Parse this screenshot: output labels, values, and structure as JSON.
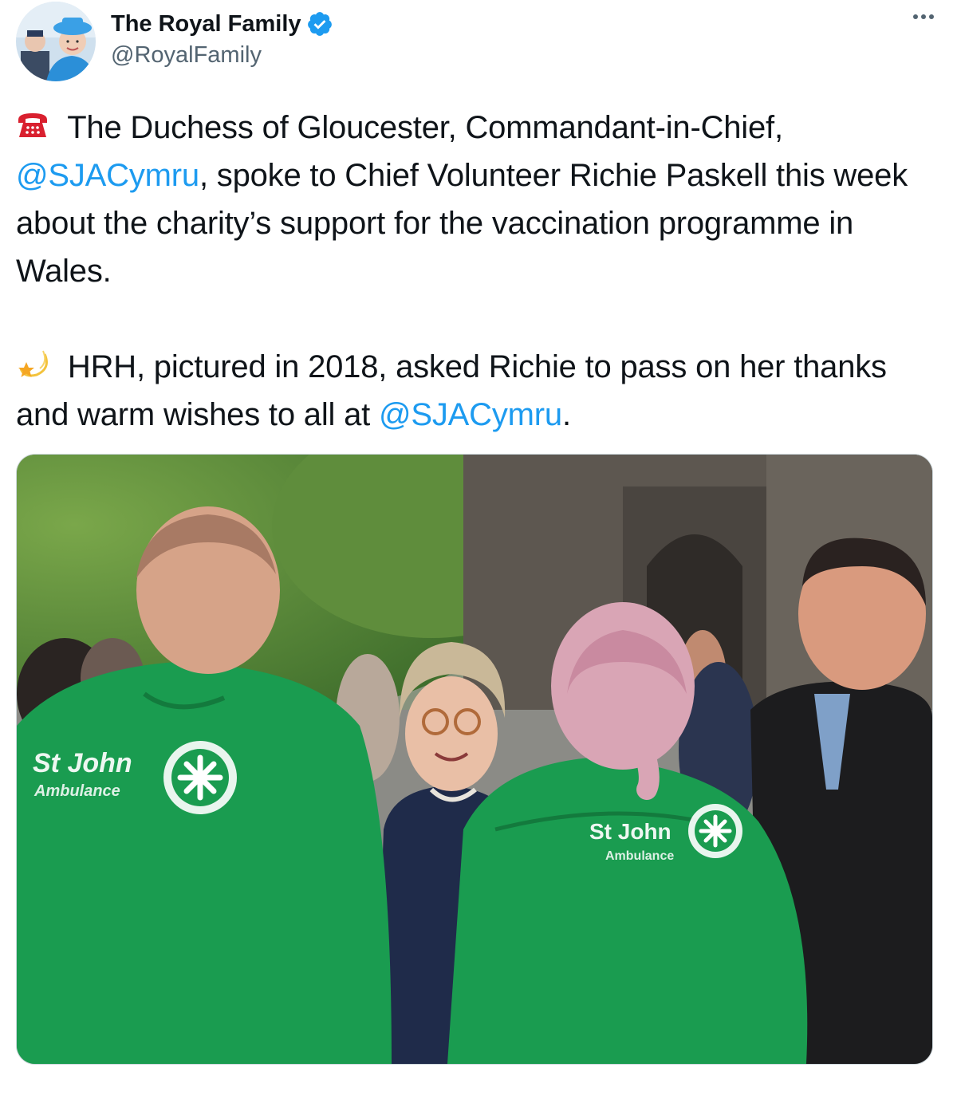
{
  "author": {
    "display_name": "The Royal Family",
    "handle": "@RoyalFamily",
    "verified": true,
    "avatar_icon": "avatar-photo"
  },
  "more_icon": "more-dots-icon",
  "tweet": {
    "paragraph1": {
      "emoji": "telephone-emoji",
      "before": " The Duchess of Gloucester, Commandant-in-Chief, ",
      "mention": "@SJACymru",
      "after": ", spoke to Chief Volunteer Richie Paskell this week about the charity’s support for the vaccination programme in Wales."
    },
    "paragraph2": {
      "emoji": "dizzy-star-emoji",
      "before": " HRH, pictured in 2018, asked Richie to pass on her thanks and warm wishes to all at ",
      "mention": "@SJACymru",
      "after": "."
    }
  },
  "media": {
    "uniform_text_1": "St John",
    "uniform_subtext_1": "Ambulance",
    "uniform_text_2": "St John",
    "uniform_subtext_2": "Ambulance"
  },
  "colors": {
    "link": "#1d9bf0",
    "text": "#0f1419",
    "secondary": "#536471",
    "verified": "#1d9bf0",
    "uniform_green": "#1a9c50"
  }
}
